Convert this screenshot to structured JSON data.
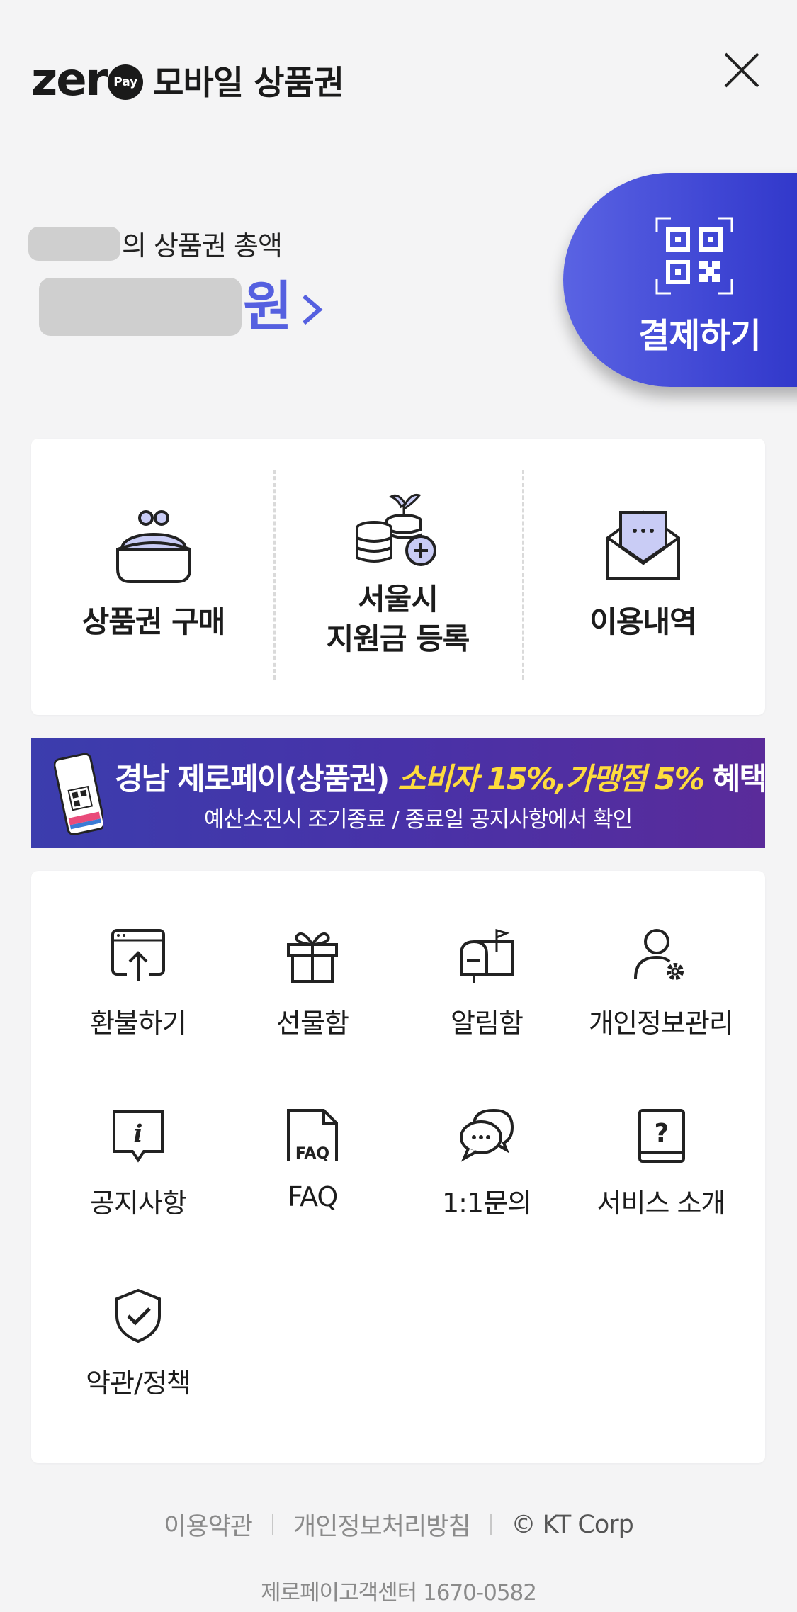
{
  "header": {
    "logo_zero": "zer",
    "logo_pay": "Pay",
    "title": "모바일 상품권"
  },
  "balance": {
    "label": "의 상품권 총액",
    "currency": "원"
  },
  "pay_button": {
    "label": "결제하기"
  },
  "main_menu": [
    {
      "label": "상품권 구매",
      "icon": "wallet-icon"
    },
    {
      "label_line1": "서울시",
      "label_line2": "지원금 등록",
      "icon": "coins-plus-icon"
    },
    {
      "label": "이용내역",
      "icon": "envelope-icon"
    }
  ],
  "banner": {
    "phone_logo": "zero",
    "main_prefix": "경남 제로페이(상품권) ",
    "consumer": "소비자 15%",
    "comma": ",",
    "merchant": "가맹점 5%",
    "suffix": " 혜택",
    "sub": "예산소진시 조기종료 / 종료일 공지사항에서 확인"
  },
  "grid_menu": [
    {
      "label": "환불하기",
      "icon": "refund-icon"
    },
    {
      "label": "선물함",
      "icon": "gift-icon"
    },
    {
      "label": "알림함",
      "icon": "mailbox-icon"
    },
    {
      "label": "개인정보관리",
      "icon": "user-settings-icon"
    },
    {
      "label": "공지사항",
      "icon": "info-icon"
    },
    {
      "label": "FAQ",
      "icon": "faq-icon"
    },
    {
      "label": "1:1문의",
      "icon": "chat-icon"
    },
    {
      "label": "서비스 소개",
      "icon": "help-book-icon"
    },
    {
      "label": "약관/정책",
      "icon": "shield-check-icon"
    }
  ],
  "footer": {
    "terms": "이용약관",
    "privacy": "개인정보처리방침",
    "copyright": "© KT Corp",
    "customer_center": "제로페이고객센터 1670-0582"
  },
  "colors": {
    "accent": "#5560e0",
    "pay_gradient_start": "#5a63e3",
    "pay_gradient_end": "#2e35c8",
    "banner_highlight": "#fedc3d",
    "icon_fill": "#c9ccf5"
  }
}
